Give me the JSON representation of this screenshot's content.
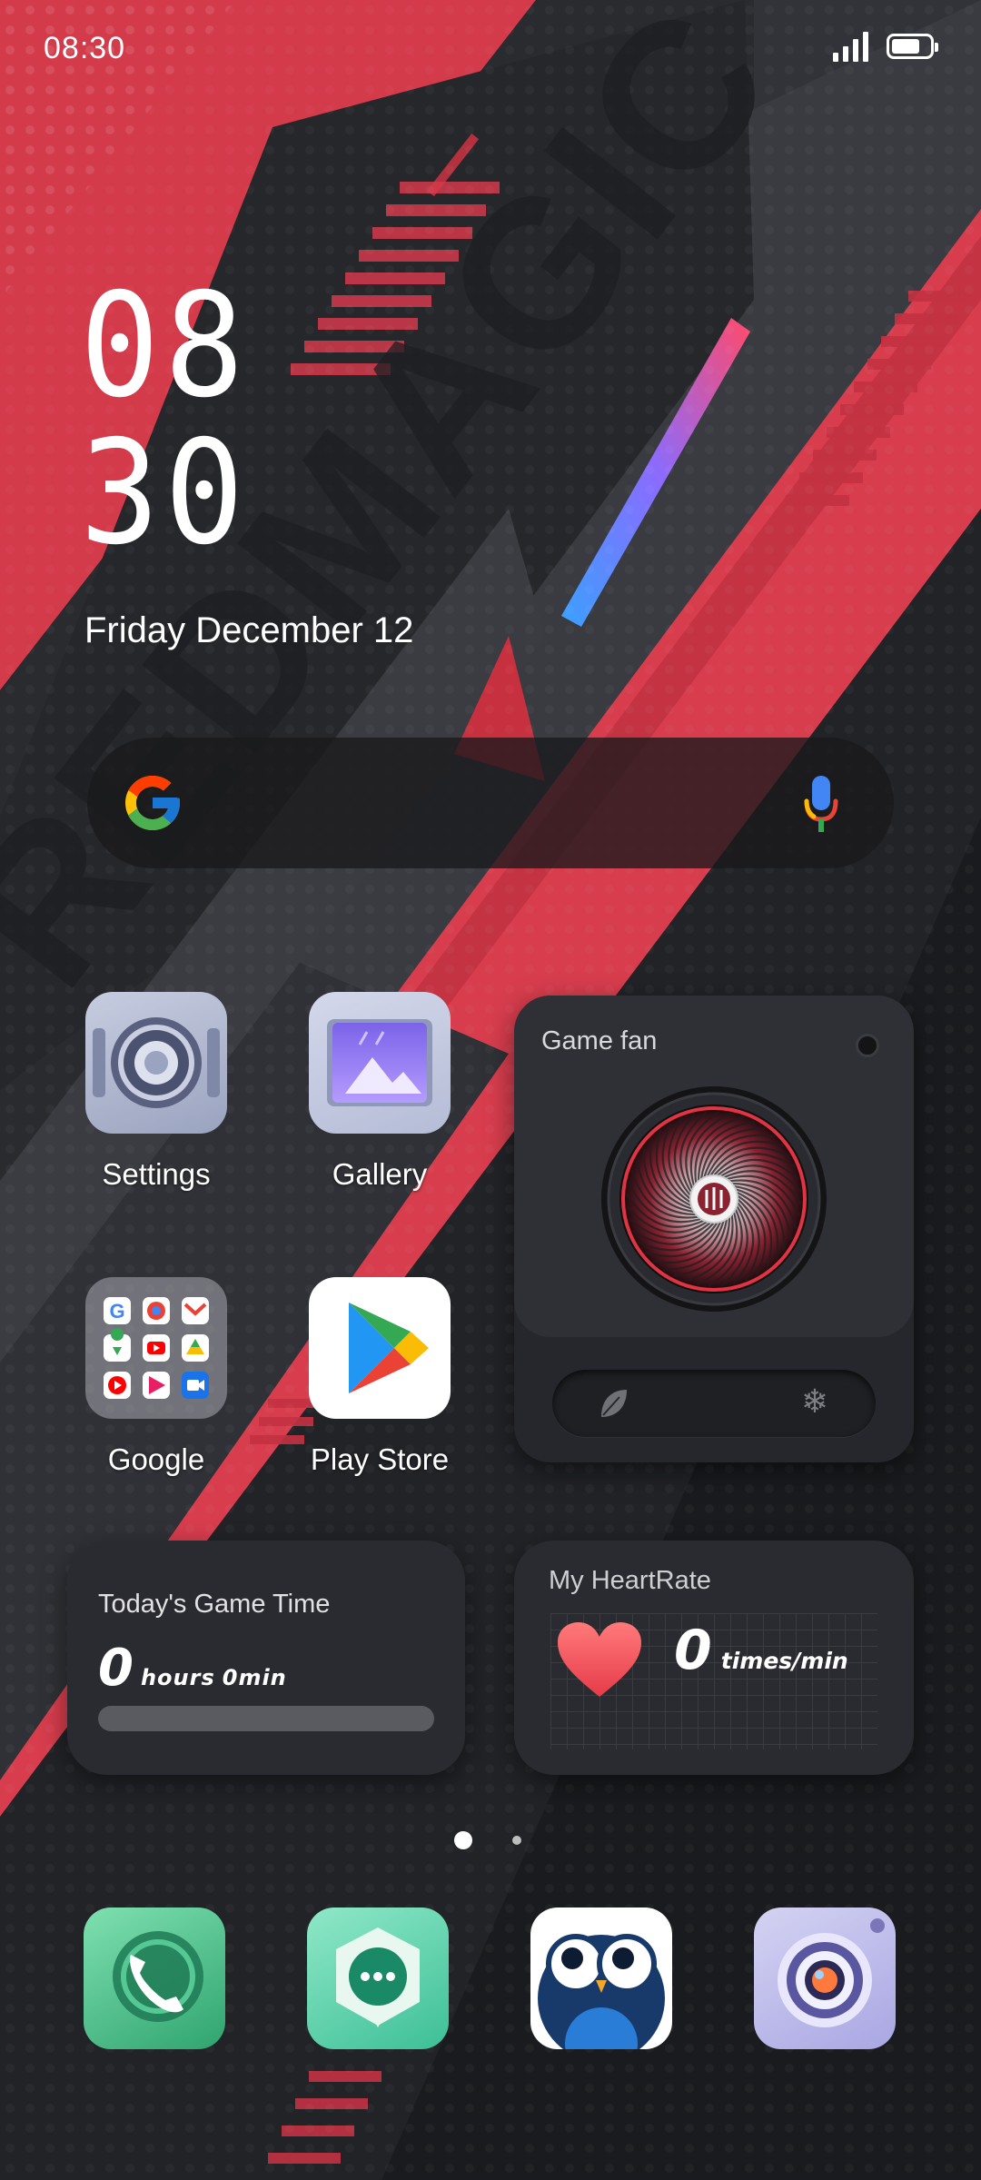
{
  "status_bar": {
    "time": "08:30",
    "battery_percent": 75
  },
  "clock": {
    "hours": "08",
    "minutes": "30",
    "date": "Friday December 12"
  },
  "wallpaper": {
    "text": "REDMAGIC"
  },
  "search_bar": {
    "logo": "google-g-icon",
    "mic": "mic-icon"
  },
  "apps": [
    {
      "label": "Settings",
      "icon": "settings-gear-icon"
    },
    {
      "label": "Gallery",
      "icon": "gallery-icon"
    },
    {
      "label": "Google",
      "icon": "google-folder-icon"
    },
    {
      "label": "Play Store",
      "icon": "play-store-icon"
    }
  ],
  "game_fan_widget": {
    "title": "Game fan",
    "modes": [
      "leaf-icon",
      "snowflake-icon"
    ]
  },
  "game_time_widget": {
    "title": "Today's Game Time",
    "hours": "0",
    "hours_unit": "hours",
    "minutes_text": "0min",
    "progress": 0
  },
  "heart_rate_widget": {
    "title": "My HeartRate",
    "value": "0",
    "unit": "times/min"
  },
  "page_indicator": {
    "pages": 2,
    "current": 1
  },
  "dock": [
    {
      "icon": "phone-icon"
    },
    {
      "icon": "messages-icon"
    },
    {
      "icon": "owl-app-icon"
    },
    {
      "icon": "camera-icon"
    }
  ],
  "colors": {
    "accent_red": "#d93a4b",
    "dark": "#1b1c20",
    "widget": "#2a2b30"
  }
}
